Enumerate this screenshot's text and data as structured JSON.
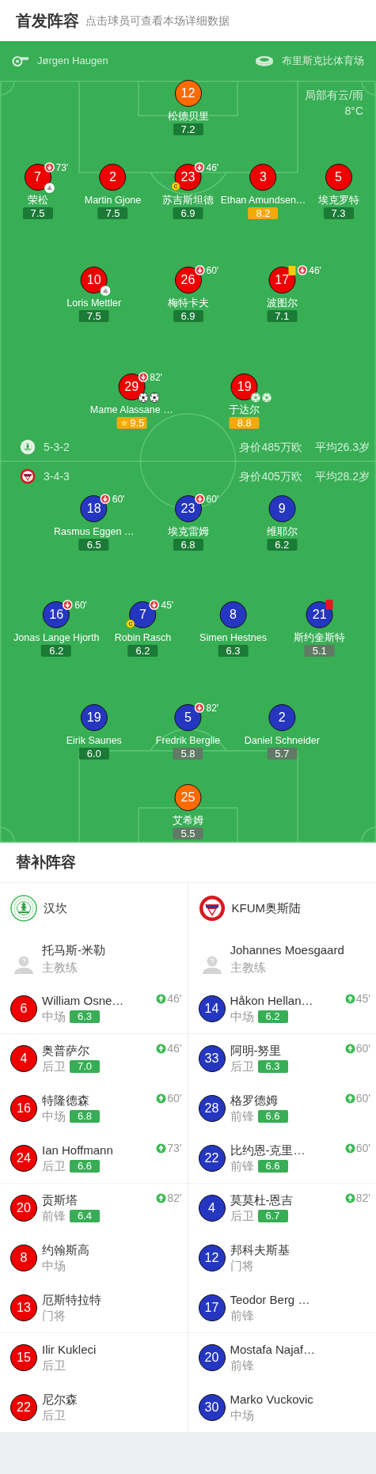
{
  "header": {
    "title": "首发阵容",
    "hint": "点击球员可查看本场详细数据"
  },
  "match": {
    "referee": "Jørgen Haugen",
    "stadium": "布里斯克比体育场",
    "weather": "局部有云/雨",
    "temperature": "8°C"
  },
  "home": {
    "formation": "5-3-2",
    "market_value": "身价485万欧",
    "average_age": "平均26.3岁",
    "lines": [
      [
        {
          "number": "12",
          "name": "松德贝里",
          "rating": "7.2",
          "color": "#1b7a36",
          "kind": "goalkeeper"
        }
      ],
      [
        {
          "number": "7",
          "name": "荣松",
          "rating": "7.5",
          "color": "#1b7a36",
          "kind": "outfield",
          "events": [
            {
              "kind": "sub_off",
              "minute": "73'"
            },
            {
              "kind": "assist"
            }
          ]
        },
        {
          "number": "2",
          "name": "Martin Gjone",
          "rating": "7.5",
          "color": "#1b7a36",
          "kind": "outfield"
        },
        {
          "number": "23",
          "name": "苏吉斯坦德",
          "rating": "6.9",
          "color": "#1b7a36",
          "kind": "outfield",
          "events": [
            {
              "kind": "sub_off",
              "minute": "46'"
            },
            {
              "kind": "captain",
              "label": "C"
            }
          ]
        },
        {
          "number": "3",
          "name": "Ethan Amundsen…",
          "rating": "8.2",
          "color": "#f0ab0a",
          "kind": "outfield"
        },
        {
          "number": "5",
          "name": "埃克罗特",
          "rating": "7.3",
          "color": "#1b7a36",
          "kind": "outfield"
        }
      ],
      [
        {
          "number": "10",
          "name": "Loris Mettler",
          "rating": "7.5",
          "color": "#1b7a36",
          "kind": "outfield",
          "events": [
            {
              "kind": "assist"
            }
          ]
        },
        {
          "number": "26",
          "name": "梅特卡夫",
          "rating": "6.9",
          "color": "#1b7a36",
          "kind": "outfield",
          "events": [
            {
              "kind": "sub_off",
              "minute": "60'"
            }
          ]
        },
        {
          "number": "17",
          "name": "波图尔",
          "rating": "7.1",
          "color": "#1b7a36",
          "kind": "outfield",
          "events": [
            {
              "kind": "yellow_card"
            },
            {
              "kind": "sub_off",
              "minute": "46'"
            }
          ]
        }
      ],
      [
        {
          "number": "29",
          "name": "Mame Alassane …",
          "rating": "9.5",
          "color": "#f0ab0a",
          "kind": "outfield",
          "mvp": true,
          "events": [
            {
              "kind": "sub_off",
              "minute": "82'"
            },
            {
              "kind": "goal"
            },
            {
              "kind": "goal"
            }
          ]
        },
        {
          "number": "19",
          "name": "于达尔",
          "rating": "8.8",
          "color": "#f0ab0a",
          "kind": "outfield",
          "events": [
            {
              "kind": "goal_alt"
            },
            {
              "kind": "goal_alt"
            }
          ]
        }
      ]
    ]
  },
  "away": {
    "formation": "3-4-3",
    "market_value": "身价405万欧",
    "average_age": "平均28.2岁",
    "lines": [
      [
        {
          "number": "18",
          "name": "Rasmus Eggen …",
          "rating": "6.5",
          "color": "#1b7a36",
          "kind": "outfield",
          "events": [
            {
              "kind": "sub_off",
              "minute": "60'"
            }
          ]
        },
        {
          "number": "23",
          "name": "埃克雷姆",
          "rating": "6.8",
          "color": "#1b7a36",
          "kind": "outfield",
          "events": [
            {
              "kind": "sub_off",
              "minute": "60'"
            }
          ]
        },
        {
          "number": "9",
          "name": "维耶尔",
          "rating": "6.2",
          "color": "#1b7a36",
          "kind": "outfield"
        }
      ],
      [
        {
          "number": "16",
          "name": "Jonas Lange Hjorth",
          "rating": "6.2",
          "color": "#1b7a36",
          "kind": "outfield",
          "events": [
            {
              "kind": "sub_off",
              "minute": "60'"
            }
          ]
        },
        {
          "number": "7",
          "name": "Robin Rasch",
          "rating": "6.2",
          "color": "#1b7a36",
          "kind": "outfield",
          "events": [
            {
              "kind": "sub_off",
              "minute": "45'"
            },
            {
              "kind": "captain",
              "label": "C"
            }
          ]
        },
        {
          "number": "8",
          "name": "Simen Hestnes",
          "rating": "6.3",
          "color": "#1b7a36",
          "kind": "outfield"
        },
        {
          "number": "21",
          "name": "斯约奎斯特",
          "rating": "5.1",
          "color": "#607a66",
          "kind": "outfield",
          "events": [
            {
              "kind": "red_card"
            }
          ]
        }
      ],
      [
        {
          "number": "19",
          "name": "Eirik Saunes",
          "rating": "6.0",
          "color": "#1b7a36",
          "kind": "outfield"
        },
        {
          "number": "5",
          "name": "Fredrik Berglie",
          "rating": "5.8",
          "color": "#607a66",
          "kind": "outfield",
          "events": [
            {
              "kind": "sub_off",
              "minute": "82'"
            }
          ]
        },
        {
          "number": "2",
          "name": "Daniel Schneider",
          "rating": "5.7",
          "color": "#607a66",
          "kind": "outfield"
        }
      ],
      [
        {
          "number": "25",
          "name": "艾希姆",
          "rating": "5.5",
          "color": "#607a66",
          "kind": "goalkeeper"
        }
      ]
    ]
  },
  "substitutes": {
    "title": "替补阵容",
    "teams": [
      {
        "name": "汉坎"
      },
      {
        "name": "KFUM奥斯陆"
      }
    ],
    "coaches": [
      {
        "name": "托马斯-米勒",
        "role": "主教练"
      },
      {
        "name": "Johannes Moesgaard",
        "role": "主教练"
      }
    ],
    "groups": [
      [
        {
          "home": {
            "number": "6",
            "name": "William Osne…",
            "position": "中场",
            "rating": "6.3",
            "sub_on": "46'"
          },
          "away": {
            "number": "14",
            "name": "Håkon Hellan…",
            "position": "中场",
            "rating": "6.2",
            "sub_on": "45'"
          }
        }
      ],
      [
        {
          "home": {
            "number": "4",
            "name": "奥普萨尔",
            "position": "后卫",
            "rating": "7.0",
            "sub_on": "46'"
          },
          "away": {
            "number": "33",
            "name": "阿明-努里",
            "position": "后卫",
            "rating": "6.3",
            "sub_on": "60'"
          }
        },
        {
          "home": {
            "number": "16",
            "name": "特隆德森",
            "position": "中场",
            "rating": "6.8",
            "sub_on": "60'"
          },
          "away": {
            "number": "28",
            "name": "格罗德姆",
            "position": "前锋",
            "rating": "6.6",
            "sub_on": "60'"
          }
        },
        {
          "home": {
            "number": "24",
            "name": "Ian Hoffmann",
            "position": "后卫",
            "rating": "6.6",
            "sub_on": "73'"
          },
          "away": {
            "number": "22",
            "name": "比约恩-克里…",
            "position": "前锋",
            "rating": "6.6",
            "sub_on": "60'"
          }
        }
      ],
      [
        {
          "home": {
            "number": "20",
            "name": "贡斯塔",
            "position": "前锋",
            "rating": "6.4",
            "sub_on": "82'"
          },
          "away": {
            "number": "4",
            "name": "莫莫杜-恩吉",
            "position": "后卫",
            "rating": "6.7",
            "sub_on": "82'"
          }
        },
        {
          "home": {
            "number": "8",
            "name": "约翰斯高",
            "position": "中场"
          },
          "away": {
            "number": "12",
            "name": "邦科夫斯基",
            "position": "门将"
          }
        },
        {
          "home": {
            "number": "13",
            "name": "厄斯特拉特",
            "position": "门将"
          },
          "away": {
            "number": "17",
            "name": "Teodor Berg …",
            "position": "前锋"
          }
        }
      ],
      [
        {
          "home": {
            "number": "15",
            "name": "Ilir Kukleci",
            "position": "后卫"
          },
          "away": {
            "number": "20",
            "name": "Mostafa Najaf…",
            "position": "前锋"
          }
        },
        {
          "home": {
            "number": "22",
            "name": "尼尔森",
            "position": "后卫"
          },
          "away": {
            "number": "30",
            "name": "Marko Vuckovic",
            "position": "中场"
          }
        }
      ]
    ]
  }
}
